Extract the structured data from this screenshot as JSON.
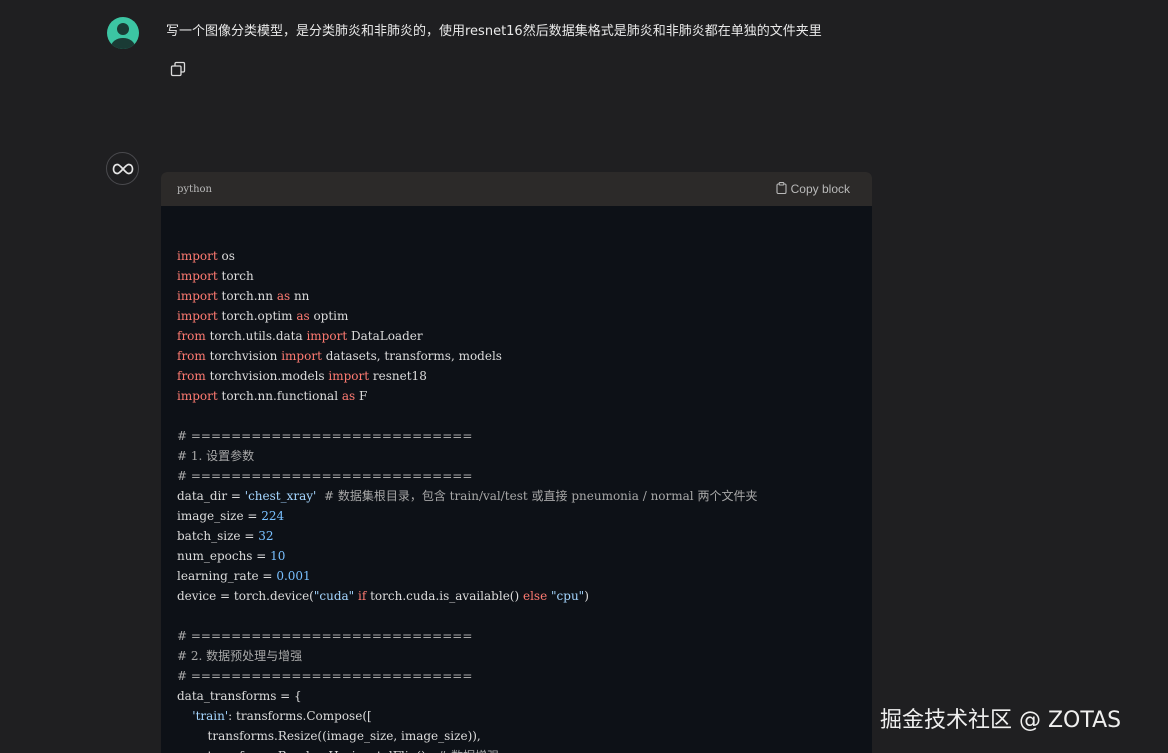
{
  "user_message": {
    "text": "写一个图像分类模型，是分类肺炎和非肺炎的，使用resnet16然后数据集格式是肺炎和非肺炎都在单独的文件夹里"
  },
  "icons": {
    "user_avatar": "user-avatar-icon",
    "copy_message": "copy-icon",
    "assistant_avatar": "infinity-logo-icon",
    "clipboard": "clipboard-icon"
  },
  "colors": {
    "background": "#1f1f21",
    "code_bg": "#0d1117",
    "code_header_bg": "#2c2a29",
    "keyword": "#ff7b72",
    "number": "#79c0ff",
    "avatar": "#3cc5a3"
  },
  "code_block": {
    "language": "python",
    "copy_label": "Copy block",
    "lines": [
      [
        [
          "kw",
          "import"
        ],
        [
          "p",
          " os"
        ]
      ],
      [
        [
          "kw",
          "import"
        ],
        [
          "p",
          " torch"
        ]
      ],
      [
        [
          "kw",
          "import"
        ],
        [
          "p",
          " torch.nn "
        ],
        [
          "kw",
          "as"
        ],
        [
          "p",
          " nn"
        ]
      ],
      [
        [
          "kw",
          "import"
        ],
        [
          "p",
          " torch.optim "
        ],
        [
          "kw",
          "as"
        ],
        [
          "p",
          " optim"
        ]
      ],
      [
        [
          "kw",
          "from"
        ],
        [
          "p",
          " torch.utils.data "
        ],
        [
          "kw",
          "import"
        ],
        [
          "p",
          " DataLoader"
        ]
      ],
      [
        [
          "kw",
          "from"
        ],
        [
          "p",
          " torchvision "
        ],
        [
          "kw",
          "import"
        ],
        [
          "p",
          " datasets, transforms, models"
        ]
      ],
      [
        [
          "kw",
          "from"
        ],
        [
          "p",
          " torchvision.models "
        ],
        [
          "kw",
          "import"
        ],
        [
          "p",
          " resnet18"
        ]
      ],
      [
        [
          "kw",
          "import"
        ],
        [
          "p",
          " torch.nn.functional "
        ],
        [
          "kw",
          "as"
        ],
        [
          "p",
          " F"
        ]
      ],
      [],
      [
        [
          "com",
          "# ============================"
        ]
      ],
      [
        [
          "com",
          "# 1. 设置参数"
        ]
      ],
      [
        [
          "com",
          "# ============================"
        ]
      ],
      [
        [
          "p",
          "data_dir = "
        ],
        [
          "str",
          "'chest_xray'"
        ],
        [
          "p",
          "  "
        ],
        [
          "com",
          "# 数据集根目录，包含 train/val/test 或直接 pneumonia / normal 两个文件夹"
        ]
      ],
      [
        [
          "p",
          "image_size = "
        ],
        [
          "num",
          "224"
        ]
      ],
      [
        [
          "p",
          "batch_size = "
        ],
        [
          "num",
          "32"
        ]
      ],
      [
        [
          "p",
          "num_epochs = "
        ],
        [
          "num",
          "10"
        ]
      ],
      [
        [
          "p",
          "learning_rate = "
        ],
        [
          "num",
          "0.001"
        ]
      ],
      [
        [
          "p",
          "device = torch.device("
        ],
        [
          "str",
          "\"cuda\""
        ],
        [
          "p",
          " "
        ],
        [
          "kw",
          "if"
        ],
        [
          "p",
          " torch.cuda.is_available() "
        ],
        [
          "kw",
          "else"
        ],
        [
          "p",
          " "
        ],
        [
          "str",
          "\"cpu\""
        ],
        [
          "p",
          ")"
        ]
      ],
      [],
      [
        [
          "com",
          "# ============================"
        ]
      ],
      [
        [
          "com",
          "# 2. 数据预处理与增强"
        ]
      ],
      [
        [
          "com",
          "# ============================"
        ]
      ],
      [
        [
          "p",
          "data_transforms = {"
        ]
      ],
      [
        [
          "p",
          "    "
        ],
        [
          "str",
          "'train'"
        ],
        [
          "p",
          ": transforms.Compose(["
        ]
      ],
      [
        [
          "p",
          "        transforms.Resize((image_size, image_size)),"
        ]
      ],
      [
        [
          "p",
          "        transforms.RandomHorizontalFlip(),  "
        ],
        [
          "com",
          "# 数据增强"
        ]
      ]
    ]
  },
  "watermark": {
    "text": "掘金技术社区 @ ZOTAS"
  }
}
